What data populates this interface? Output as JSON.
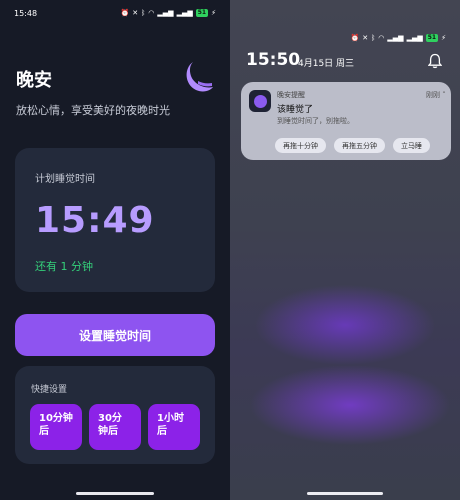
{
  "left": {
    "status": {
      "time": "15:48",
      "icons": [
        "alarm-icon",
        "mute-icon",
        "bluetooth-icon",
        "wifi-icon",
        "signal-icon",
        "signal-icon"
      ],
      "battery": "51"
    },
    "title": "晚安",
    "subtitle": "放松心情，享受美好的夜晚时光",
    "plan": {
      "label": "计划睡觉时间",
      "time": "15:49",
      "remaining": "还有 1 分钟"
    },
    "primary_button": "设置睡觉时间",
    "quick": {
      "label": "快捷设置",
      "options": [
        {
          "line1": "10分钟",
          "line2": "后"
        },
        {
          "line1": "30分",
          "line2": "钟后"
        },
        {
          "line1": "1小时",
          "line2": "后"
        }
      ]
    },
    "colors": {
      "background": "#161a26",
      "card": "#232a3b",
      "accent": "#8e54f0",
      "time_purple": "#b79cff",
      "remaining_green": "#34d07a",
      "quick_button": "#8c22e8"
    }
  },
  "right": {
    "status": {
      "icons": [
        "alarm-icon",
        "mute-icon",
        "bluetooth-icon",
        "wifi-icon",
        "signal-icon",
        "signal-icon"
      ],
      "battery": "51"
    },
    "time": "15:50",
    "date": "4月15日 周三",
    "notification": {
      "app": "晚安提醒",
      "when": "刚刚",
      "title": "该睡觉了",
      "body": "到睡觉时间了，别拖啦。",
      "actions": [
        "再拖十分钟",
        "再拖五分钟",
        "立马睡"
      ]
    }
  }
}
